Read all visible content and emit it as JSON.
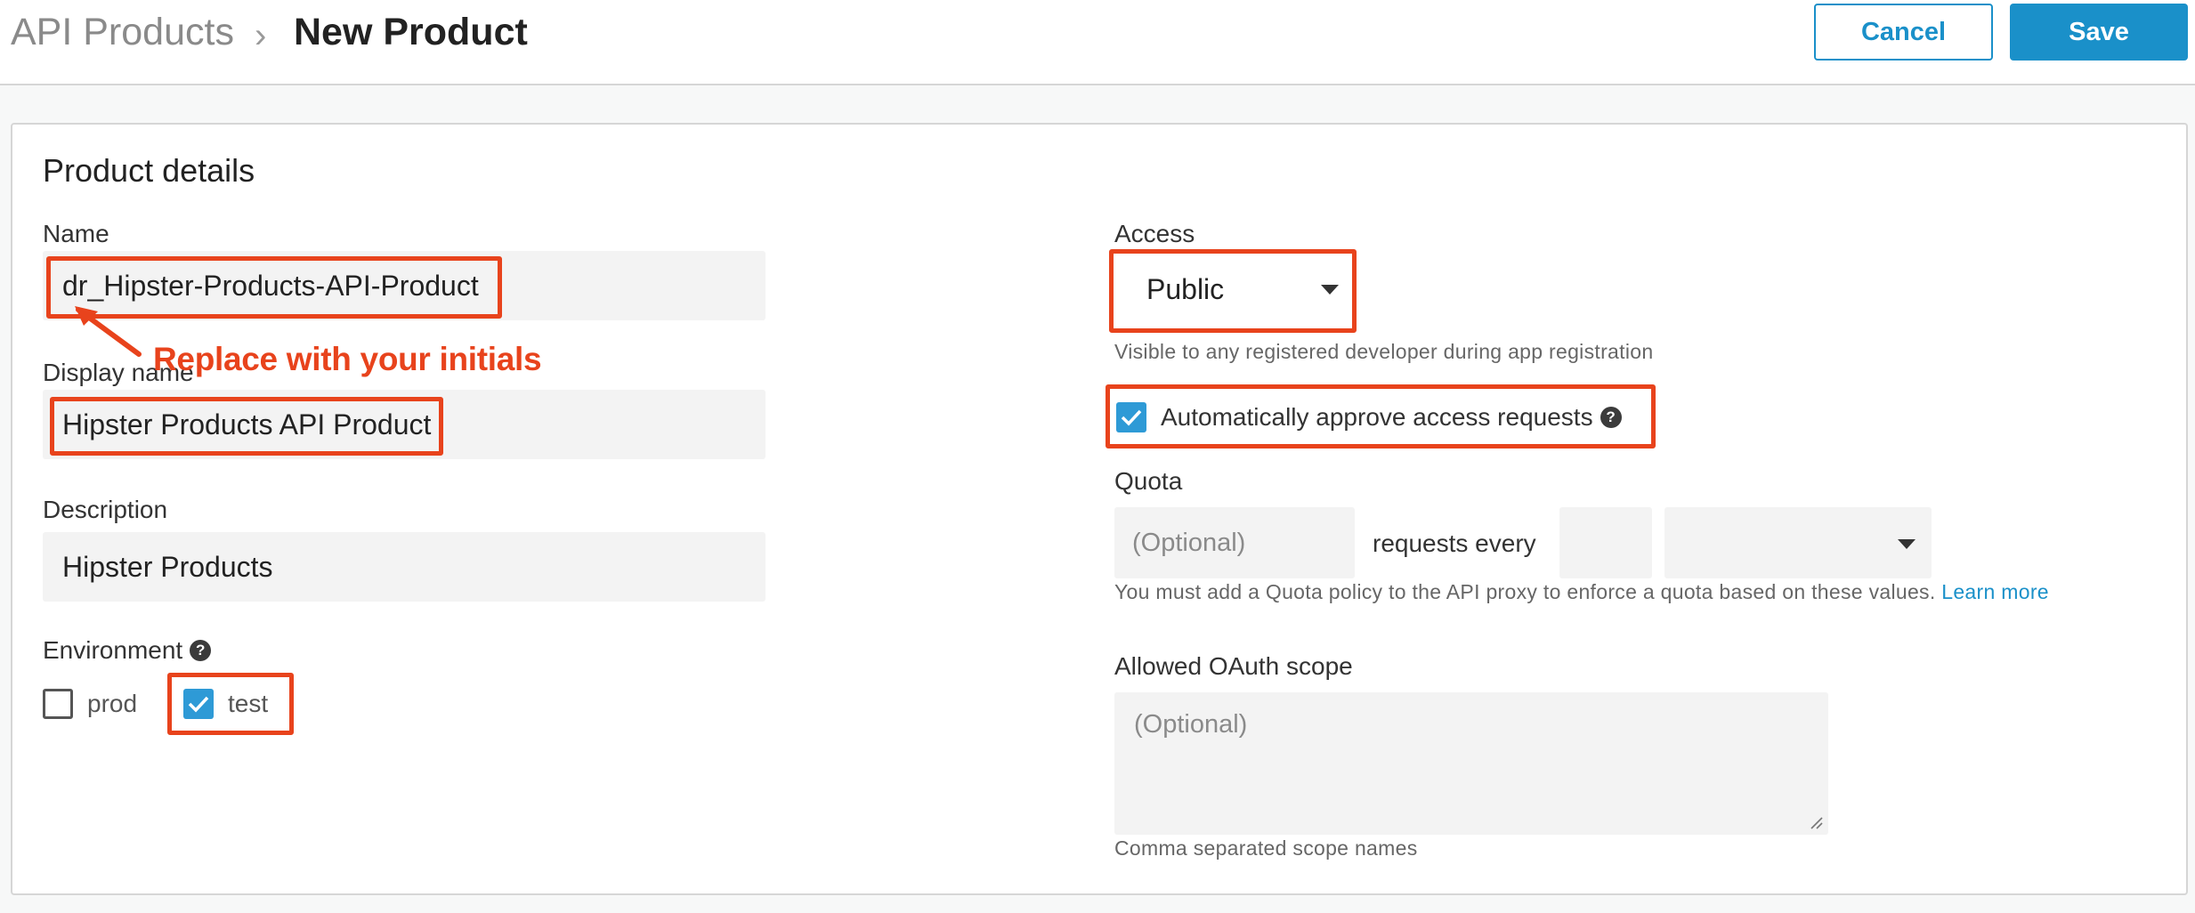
{
  "header": {
    "breadcrumb_parent": "API Products",
    "breadcrumb_separator": "›",
    "title": "New Product",
    "cancel_label": "Cancel",
    "save_label": "Save"
  },
  "form": {
    "section_title": "Product details",
    "name": {
      "label": "Name",
      "value": "dr_Hipster-Products-API-Product"
    },
    "display_name": {
      "label": "Display name",
      "value": "Hipster Products API Product"
    },
    "description": {
      "label": "Description",
      "value": "Hipster Products"
    },
    "environment": {
      "label": "Environment",
      "help_icon": "question-circle-icon",
      "options": [
        {
          "label": "prod",
          "checked": false
        },
        {
          "label": "test",
          "checked": true
        }
      ]
    },
    "access": {
      "label": "Access",
      "selected": "Public",
      "help_text": "Visible to any registered developer during app registration"
    },
    "auto_approve": {
      "label": "Automatically approve access requests",
      "checked": true
    },
    "quota": {
      "label": "Quota",
      "amount_placeholder": "(Optional)",
      "requests_every": "requests every",
      "interval_value": "",
      "unit_selected": "",
      "help_text": "You must add a Quota policy to the API proxy to enforce a quota based on these values.",
      "learn_more": "Learn more"
    },
    "oauth_scope": {
      "label": "Allowed OAuth scope",
      "placeholder": "(Optional)",
      "help_text": "Comma separated scope names"
    }
  },
  "annotation": {
    "text": "Replace with your initials"
  },
  "colors": {
    "accent": "#1a90c9",
    "annotation": "#e8431c",
    "checkbox": "#2e9ad6"
  }
}
